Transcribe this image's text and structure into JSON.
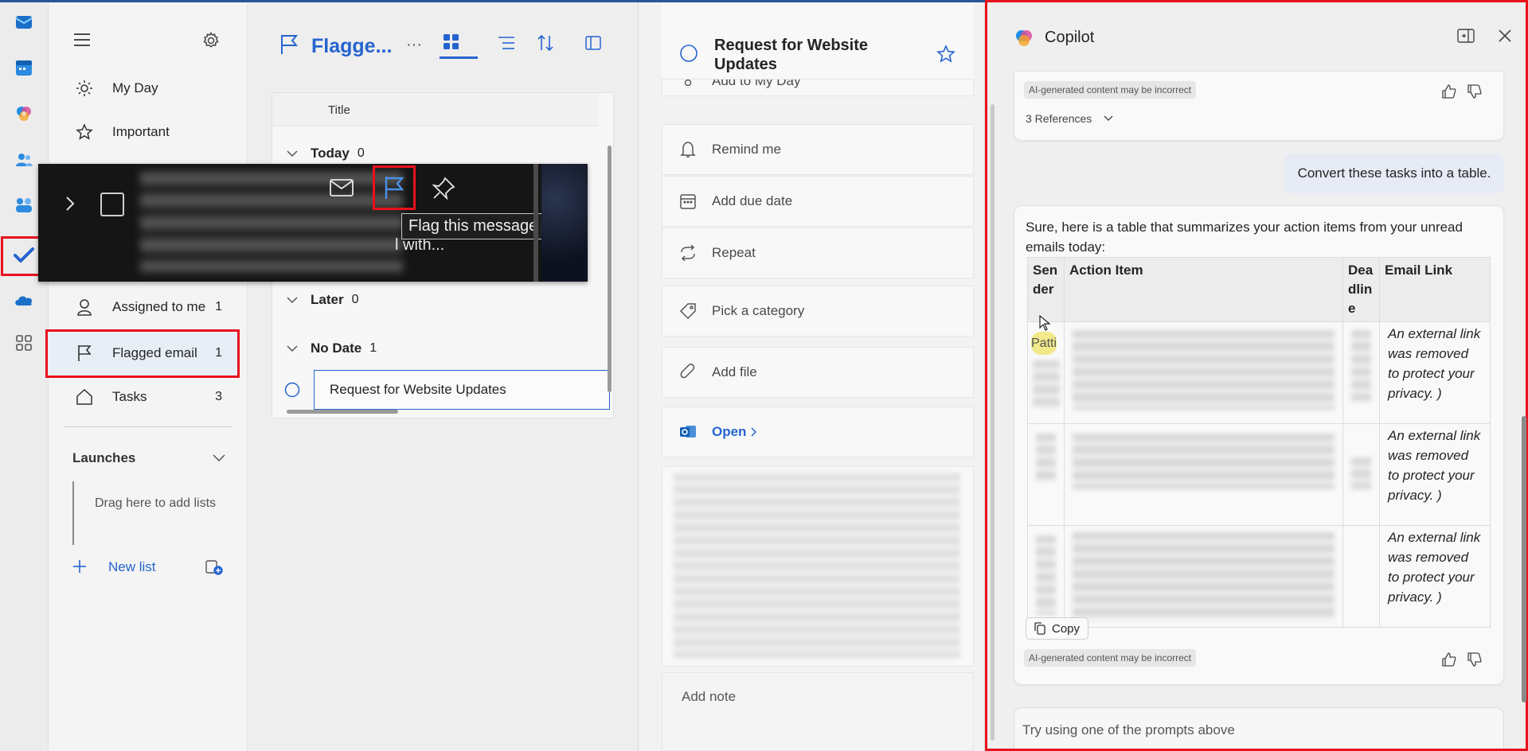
{
  "rail": {
    "apps": [
      "outlook-icon",
      "calendar-icon",
      "copilot-icon",
      "people-icon",
      "teams-icon",
      "todo-icon",
      "onedrive-icon",
      "apps-icon"
    ]
  },
  "sidebar": {
    "items": [
      {
        "label": "My Day",
        "count": ""
      },
      {
        "label": "Important",
        "count": ""
      },
      {
        "label": "Assigned to me",
        "count": "1"
      },
      {
        "label": "Flagged email",
        "count": "1"
      },
      {
        "label": "Tasks",
        "count": "3"
      }
    ],
    "launches_label": "Launches",
    "drag_hint": "Drag here to add lists",
    "new_list_label": "New list"
  },
  "list": {
    "title": "Flagge...",
    "more": "···",
    "column_title": "Title",
    "groups": [
      {
        "label": "Today",
        "count": "0"
      },
      {
        "label": "Later",
        "count": "0"
      },
      {
        "label": "No Date",
        "count": "1"
      }
    ],
    "task": "Request for Website Updates"
  },
  "popup": {
    "partial_text": "l with...",
    "tooltip": "Flag this message"
  },
  "detail": {
    "title": "Request for Website Updates",
    "partial": "Add to My Day",
    "remind": "Remind me",
    "due": "Add due date",
    "repeat": "Repeat",
    "category": "Pick a category",
    "file": "Add file",
    "open": "Open",
    "note": "Add note"
  },
  "copilot": {
    "title": "Copilot",
    "ai_tag": "AI-generated content may be incorrect",
    "references": "3 References",
    "user_msg": "Convert these tasks into a table.",
    "reply_intro": "Sure, here is a table that summarizes your action items from your unread emails today:",
    "table_headers": {
      "sender": "Sender",
      "action": "Action Item",
      "deadline": "Deadline",
      "link": "Email Link"
    },
    "sender_partial": "Patti",
    "link_text": "An external link was removed to protect your privacy. )",
    "copy_label": "Copy",
    "input_placeholder": "Try using one of the prompts above"
  },
  "colors": {
    "accent": "#2564cf",
    "highlight": "#e8121d"
  }
}
